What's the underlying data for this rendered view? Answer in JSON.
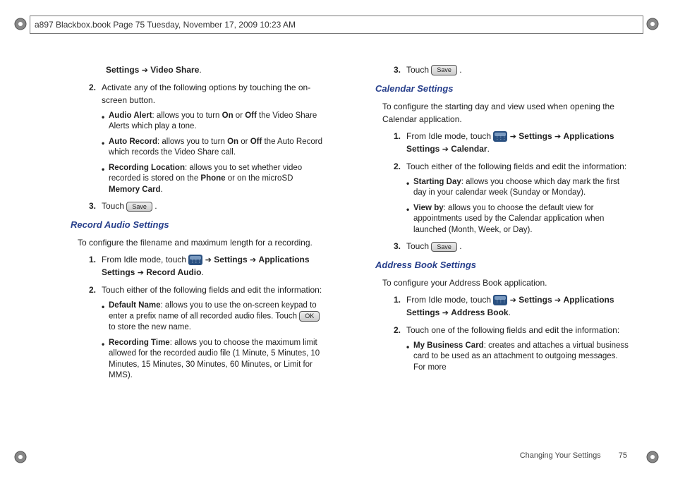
{
  "header": {
    "text": "a897 Blackbox.book  Page 75  Tuesday, November 17, 2009  10:23 AM"
  },
  "ui": {
    "save": "Save",
    "ok": "OK",
    "menu": "Menu",
    "arrow": "➔"
  },
  "left": {
    "bc1": {
      "pre": "Settings",
      "post": "Video Share"
    },
    "item2": "Activate any of the following options by touching the on-screen button.",
    "b1": {
      "bold": "Audio Alert",
      "rest": ": allows you to turn ",
      "on": "On",
      "mid": " or ",
      "off": "Off",
      "end": " the Video Share Alerts which play a tone."
    },
    "b2": {
      "bold": "Auto Record",
      "rest": ": allows you to turn ",
      "on": "On",
      "mid": " or ",
      "off": "Off",
      "end": " the Auto Record which records the Video Share call."
    },
    "b3": {
      "bold": "Recording Location",
      "rest": ": allows you to set whether video recorded is stored on the ",
      "phone": "Phone",
      "mid": " or on the microSD ",
      "card": "Memory Card",
      "end": "."
    },
    "item3": "Touch ",
    "section2": "Record Audio Settings",
    "intro2": "To configure the filename and maximum length for a recording.",
    "s2_1a": "From Idle mode, touch ",
    "s2_1b": "Settings",
    "s2_1c": "Applications Settings",
    "s2_1d": "Record Audio",
    "s2_2": "Touch either of the following fields and edit the information:",
    "s2_b1": {
      "bold": "Default Name",
      "rest": ": allows you to use the on-screen keypad to enter a prefix name of all recorded audio files. Touch ",
      "end": " to store the new name."
    },
    "s2_b2": {
      "bold": "Recording Time",
      "rest": ": allows you to choose the maximum limit allowed for the recorded audio file (1 Minute, 5 Minutes, 10 Minutes, 15 Minutes, 30 Minutes, 60 Minutes, or Limit for MMS)."
    }
  },
  "right": {
    "item3": "Touch ",
    "sectionCal": "Calendar Settings",
    "introCal": "To configure the starting day and view used when opening the Calendar application.",
    "cal_1a": "From Idle mode, touch ",
    "cal_1b": "Settings",
    "cal_1c": "Applications Settings",
    "cal_1d": "Calendar",
    "cal_2": "Touch either of the following fields and edit the information:",
    "cal_b1": {
      "bold": "Starting Day",
      "rest": ": allows you choose which day mark the first day in your calendar week (Sunday or Monday)."
    },
    "cal_b2": {
      "bold": "View by",
      "rest": ": allows you to choose the default view for appointments used by the Calendar application when launched (Month, Week, or Day)."
    },
    "cal_3": "Touch ",
    "sectionAddr": "Address Book Settings",
    "introAddr": "To configure your Address Book application.",
    "ad_1a": "From Idle mode, touch ",
    "ad_1b": "Settings",
    "ad_1c": "Applications Settings",
    "ad_1d": "Address Book",
    "ad_2": "Touch one of the following fields and edit the information:",
    "ad_b1": {
      "bold": "My Business Card",
      "rest": ": creates and attaches a virtual business card to be used as an attachment to outgoing messages. For more"
    }
  },
  "footer": {
    "text": "Changing Your Settings",
    "page": "75"
  }
}
